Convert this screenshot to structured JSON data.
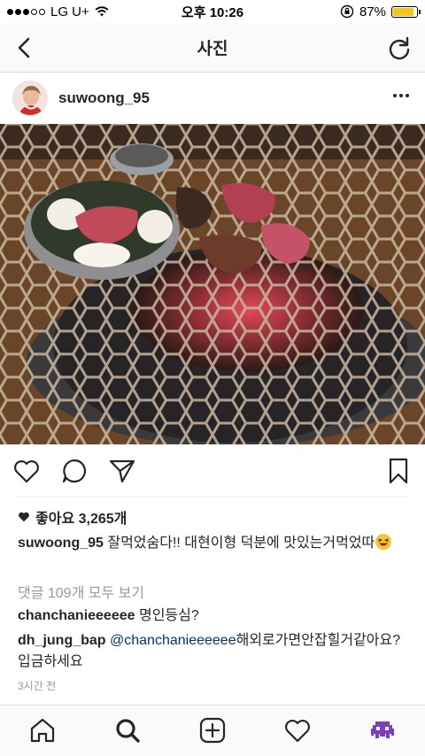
{
  "status_bar": {
    "carrier": "LG U+",
    "time": "오후 10:26",
    "battery": "87%",
    "battery_level": 0.87,
    "signal_bars_filled": 3
  },
  "nav": {
    "title": "사진",
    "back_icon": "chevron-left-icon",
    "refresh_icon": "refresh-icon"
  },
  "post": {
    "username": "suwoong_95",
    "photo_alt": "grill photo",
    "likes": "좋아요 3,265개",
    "caption_user": "suwoong_95",
    "caption_text": "잘먹었숨다!! 대현이형 덕분에 맛있는거먹었따",
    "view_comments": "댓글 109개 모두 보기",
    "comments": [
      {
        "user": "chanchanieeeeee",
        "mention": "",
        "text": "명인등심?"
      },
      {
        "user": "dh_jung_bap",
        "mention": "@chanchanieeeeee",
        "text": "해외로가면안잡힐거같아요? 입금하세요"
      }
    ],
    "time_ago": "3시간 전"
  },
  "colors": {
    "text": "#262626",
    "muted": "#999999",
    "link": "#003569",
    "divider": "#dbdbdb",
    "battery": "#f5c518"
  },
  "tabs": [
    "home-icon",
    "search-icon",
    "add-post-icon",
    "activity-heart-icon",
    "profile-avatar-icon"
  ]
}
